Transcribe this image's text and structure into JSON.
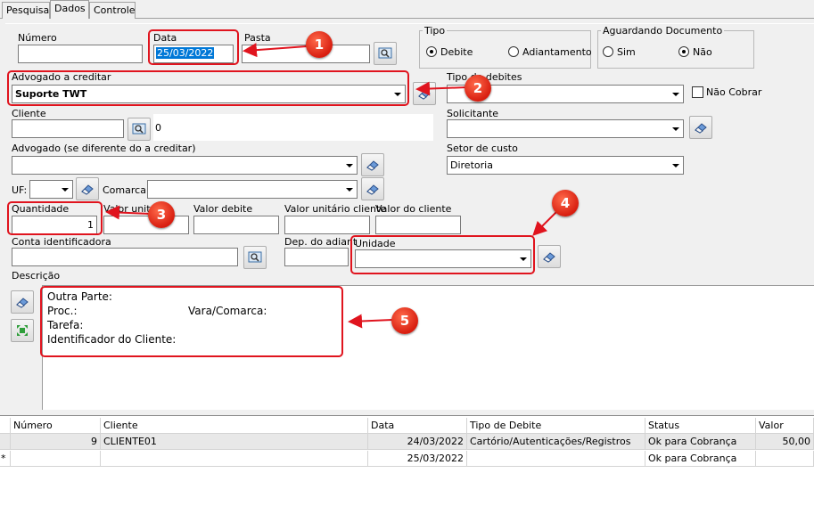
{
  "tabs": [
    "Pesquisa",
    "Dados",
    "Controle"
  ],
  "form": {
    "numero_label": "Número",
    "numero_value": "",
    "data_label": "Data",
    "data_value": "25/03/2022",
    "pasta_label": "Pasta",
    "pasta_value": "",
    "tipo_title": "Tipo",
    "tipo_debite": "Debite",
    "tipo_adiantamento": "Adiantamento",
    "aguardando_title": "Aguardando Documento",
    "aguardando_sim": "Sim",
    "aguardando_nao": "Não",
    "advogado_creditar_label": "Advogado a creditar",
    "advogado_creditar_value": "Suporte TWT",
    "tipo_debites_label": "Tipo de debites",
    "tipo_debites_value": "",
    "nao_cobrar_label": "Não Cobrar",
    "cliente_label": "Cliente",
    "cliente_value": "",
    "cliente_desc": "0",
    "solicitante_label": "Solicitante",
    "advogado_dif_label": "Advogado  (se diferente do a creditar)",
    "setor_custo_label": "Setor de custo",
    "setor_custo_value": "Diretoria",
    "uf_label": "UF:",
    "comarca_label": "Comarca:",
    "quantidade_label": "Quantidade",
    "quantidade_value": "1",
    "valor_unitario_label": "Valor unitário",
    "valor_debite_label": "Valor debite",
    "valor_unit_cliente_label": "Valor unitário cliente",
    "valor_cliente_label": "Valor do cliente",
    "conta_label": "Conta identificadora",
    "dep_label": "Dep. do adiant",
    "unidade_label": "Unidade",
    "descricao_label": "Descrição"
  },
  "memo": {
    "outra_parte": "Outra Parte:",
    "proc": "Proc.:",
    "vara": "Vara/Comarca:",
    "tarefa": "Tarefa:",
    "identificador": "Identificador do Cliente:"
  },
  "annotations": [
    "1",
    "2",
    "3",
    "4",
    "5"
  ],
  "grid": {
    "columns": [
      "Número",
      "Cliente",
      "Data",
      "Tipo de Debite",
      "Status",
      "Valor"
    ],
    "rows": [
      {
        "marker": "",
        "numero": "9",
        "cliente": "CLIENTE01",
        "data": "24/03/2022",
        "tipo": "Cartório/Autenticações/Registros",
        "status": "Ok para Cobrança",
        "valor": "50,00"
      },
      {
        "marker": "*",
        "numero": "",
        "cliente": "",
        "data": "25/03/2022",
        "tipo": "",
        "status": "Ok para Cobrança",
        "valor": ""
      }
    ]
  },
  "colors": {
    "highlight": "#e0141e",
    "badge": "#d81e10",
    "selection": "#0078d7"
  }
}
